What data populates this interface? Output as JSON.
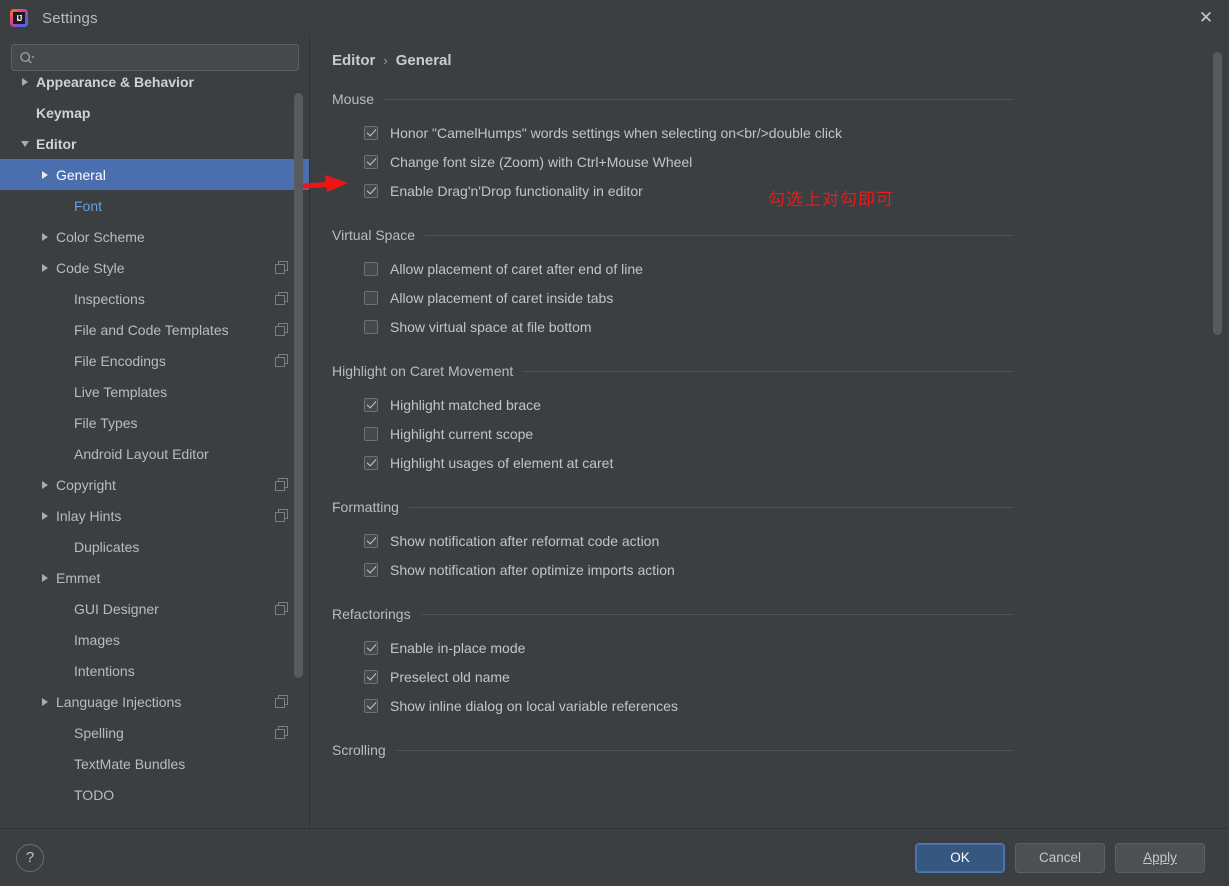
{
  "window": {
    "title": "Settings",
    "app_icon": "intellij-idea-icon",
    "close_label": "✕"
  },
  "search": {
    "placeholder": "",
    "value": "",
    "icon": "search-icon"
  },
  "sidebar": {
    "items": [
      {
        "label": "Appearance & Behavior",
        "indent": 0,
        "arrow": "right",
        "bold": true,
        "selected": false,
        "copy": false
      },
      {
        "label": "Keymap",
        "indent": 0,
        "arrow": "none",
        "bold": true,
        "selected": false,
        "copy": false
      },
      {
        "label": "Editor",
        "indent": 0,
        "arrow": "down",
        "bold": true,
        "selected": false,
        "copy": false
      },
      {
        "label": "General",
        "indent": 1,
        "arrow": "right",
        "bold": false,
        "selected": true,
        "copy": false
      },
      {
        "label": "Font",
        "indent": 2,
        "arrow": "none",
        "bold": false,
        "selected": false,
        "copy": false,
        "link": true
      },
      {
        "label": "Color Scheme",
        "indent": 1,
        "arrow": "right",
        "bold": false,
        "selected": false,
        "copy": false
      },
      {
        "label": "Code Style",
        "indent": 1,
        "arrow": "right",
        "bold": false,
        "selected": false,
        "copy": true
      },
      {
        "label": "Inspections",
        "indent": 2,
        "arrow": "none",
        "bold": false,
        "selected": false,
        "copy": true
      },
      {
        "label": "File and Code Templates",
        "indent": 2,
        "arrow": "none",
        "bold": false,
        "selected": false,
        "copy": true
      },
      {
        "label": "File Encodings",
        "indent": 2,
        "arrow": "none",
        "bold": false,
        "selected": false,
        "copy": true
      },
      {
        "label": "Live Templates",
        "indent": 2,
        "arrow": "none",
        "bold": false,
        "selected": false,
        "copy": false
      },
      {
        "label": "File Types",
        "indent": 2,
        "arrow": "none",
        "bold": false,
        "selected": false,
        "copy": false
      },
      {
        "label": "Android Layout Editor",
        "indent": 2,
        "arrow": "none",
        "bold": false,
        "selected": false,
        "copy": false
      },
      {
        "label": "Copyright",
        "indent": 1,
        "arrow": "right",
        "bold": false,
        "selected": false,
        "copy": true
      },
      {
        "label": "Inlay Hints",
        "indent": 1,
        "arrow": "right",
        "bold": false,
        "selected": false,
        "copy": true
      },
      {
        "label": "Duplicates",
        "indent": 2,
        "arrow": "none",
        "bold": false,
        "selected": false,
        "copy": false
      },
      {
        "label": "Emmet",
        "indent": 1,
        "arrow": "right",
        "bold": false,
        "selected": false,
        "copy": false
      },
      {
        "label": "GUI Designer",
        "indent": 2,
        "arrow": "none",
        "bold": false,
        "selected": false,
        "copy": true
      },
      {
        "label": "Images",
        "indent": 2,
        "arrow": "none",
        "bold": false,
        "selected": false,
        "copy": false
      },
      {
        "label": "Intentions",
        "indent": 2,
        "arrow": "none",
        "bold": false,
        "selected": false,
        "copy": false
      },
      {
        "label": "Language Injections",
        "indent": 1,
        "arrow": "right",
        "bold": false,
        "selected": false,
        "copy": true
      },
      {
        "label": "Spelling",
        "indent": 2,
        "arrow": "none",
        "bold": false,
        "selected": false,
        "copy": true
      },
      {
        "label": "TextMate Bundles",
        "indent": 2,
        "arrow": "none",
        "bold": false,
        "selected": false,
        "copy": false
      },
      {
        "label": "TODO",
        "indent": 2,
        "arrow": "none",
        "bold": false,
        "selected": false,
        "copy": false
      }
    ]
  },
  "breadcrumb": {
    "parent": "Editor",
    "separator": "›",
    "current": "General"
  },
  "sections": [
    {
      "title": "Mouse",
      "options": [
        {
          "label": "Honor \"CamelHumps\" words settings when selecting on<br/>double click",
          "checked": true
        },
        {
          "label": "Change font size (Zoom) with Ctrl+Mouse Wheel",
          "checked": true
        },
        {
          "label": "Enable Drag'n'Drop functionality in editor",
          "checked": true
        }
      ]
    },
    {
      "title": "Virtual Space",
      "options": [
        {
          "label": "Allow placement of caret after end of line",
          "checked": false
        },
        {
          "label": "Allow placement of caret inside tabs",
          "checked": false
        },
        {
          "label": "Show virtual space at file bottom",
          "checked": false
        }
      ]
    },
    {
      "title": "Highlight on Caret Movement",
      "options": [
        {
          "label": "Highlight matched brace",
          "checked": true
        },
        {
          "label": "Highlight current scope",
          "checked": false
        },
        {
          "label": "Highlight usages of element at caret",
          "checked": true
        }
      ]
    },
    {
      "title": "Formatting",
      "options": [
        {
          "label": "Show notification after reformat code action",
          "checked": true
        },
        {
          "label": "Show notification after optimize imports action",
          "checked": true
        }
      ]
    },
    {
      "title": "Refactorings",
      "options": [
        {
          "label": "Enable in-place mode",
          "checked": true
        },
        {
          "label": "Preselect old name",
          "checked": true
        },
        {
          "label": "Show inline dialog on local variable references",
          "checked": true
        }
      ]
    },
    {
      "title": "Scrolling",
      "options": []
    }
  ],
  "annotations": {
    "note_text": "勾选上对勾即可",
    "note_color": "#e81b1b",
    "arrow_color": "#f01414",
    "arrow_target": "Change font size (Zoom) with Ctrl+Mouse Wheel"
  },
  "footer": {
    "help_label": "?",
    "ok_label": "OK",
    "cancel_label": "Cancel",
    "apply_label": "Apply",
    "ok_color": "#365880"
  }
}
